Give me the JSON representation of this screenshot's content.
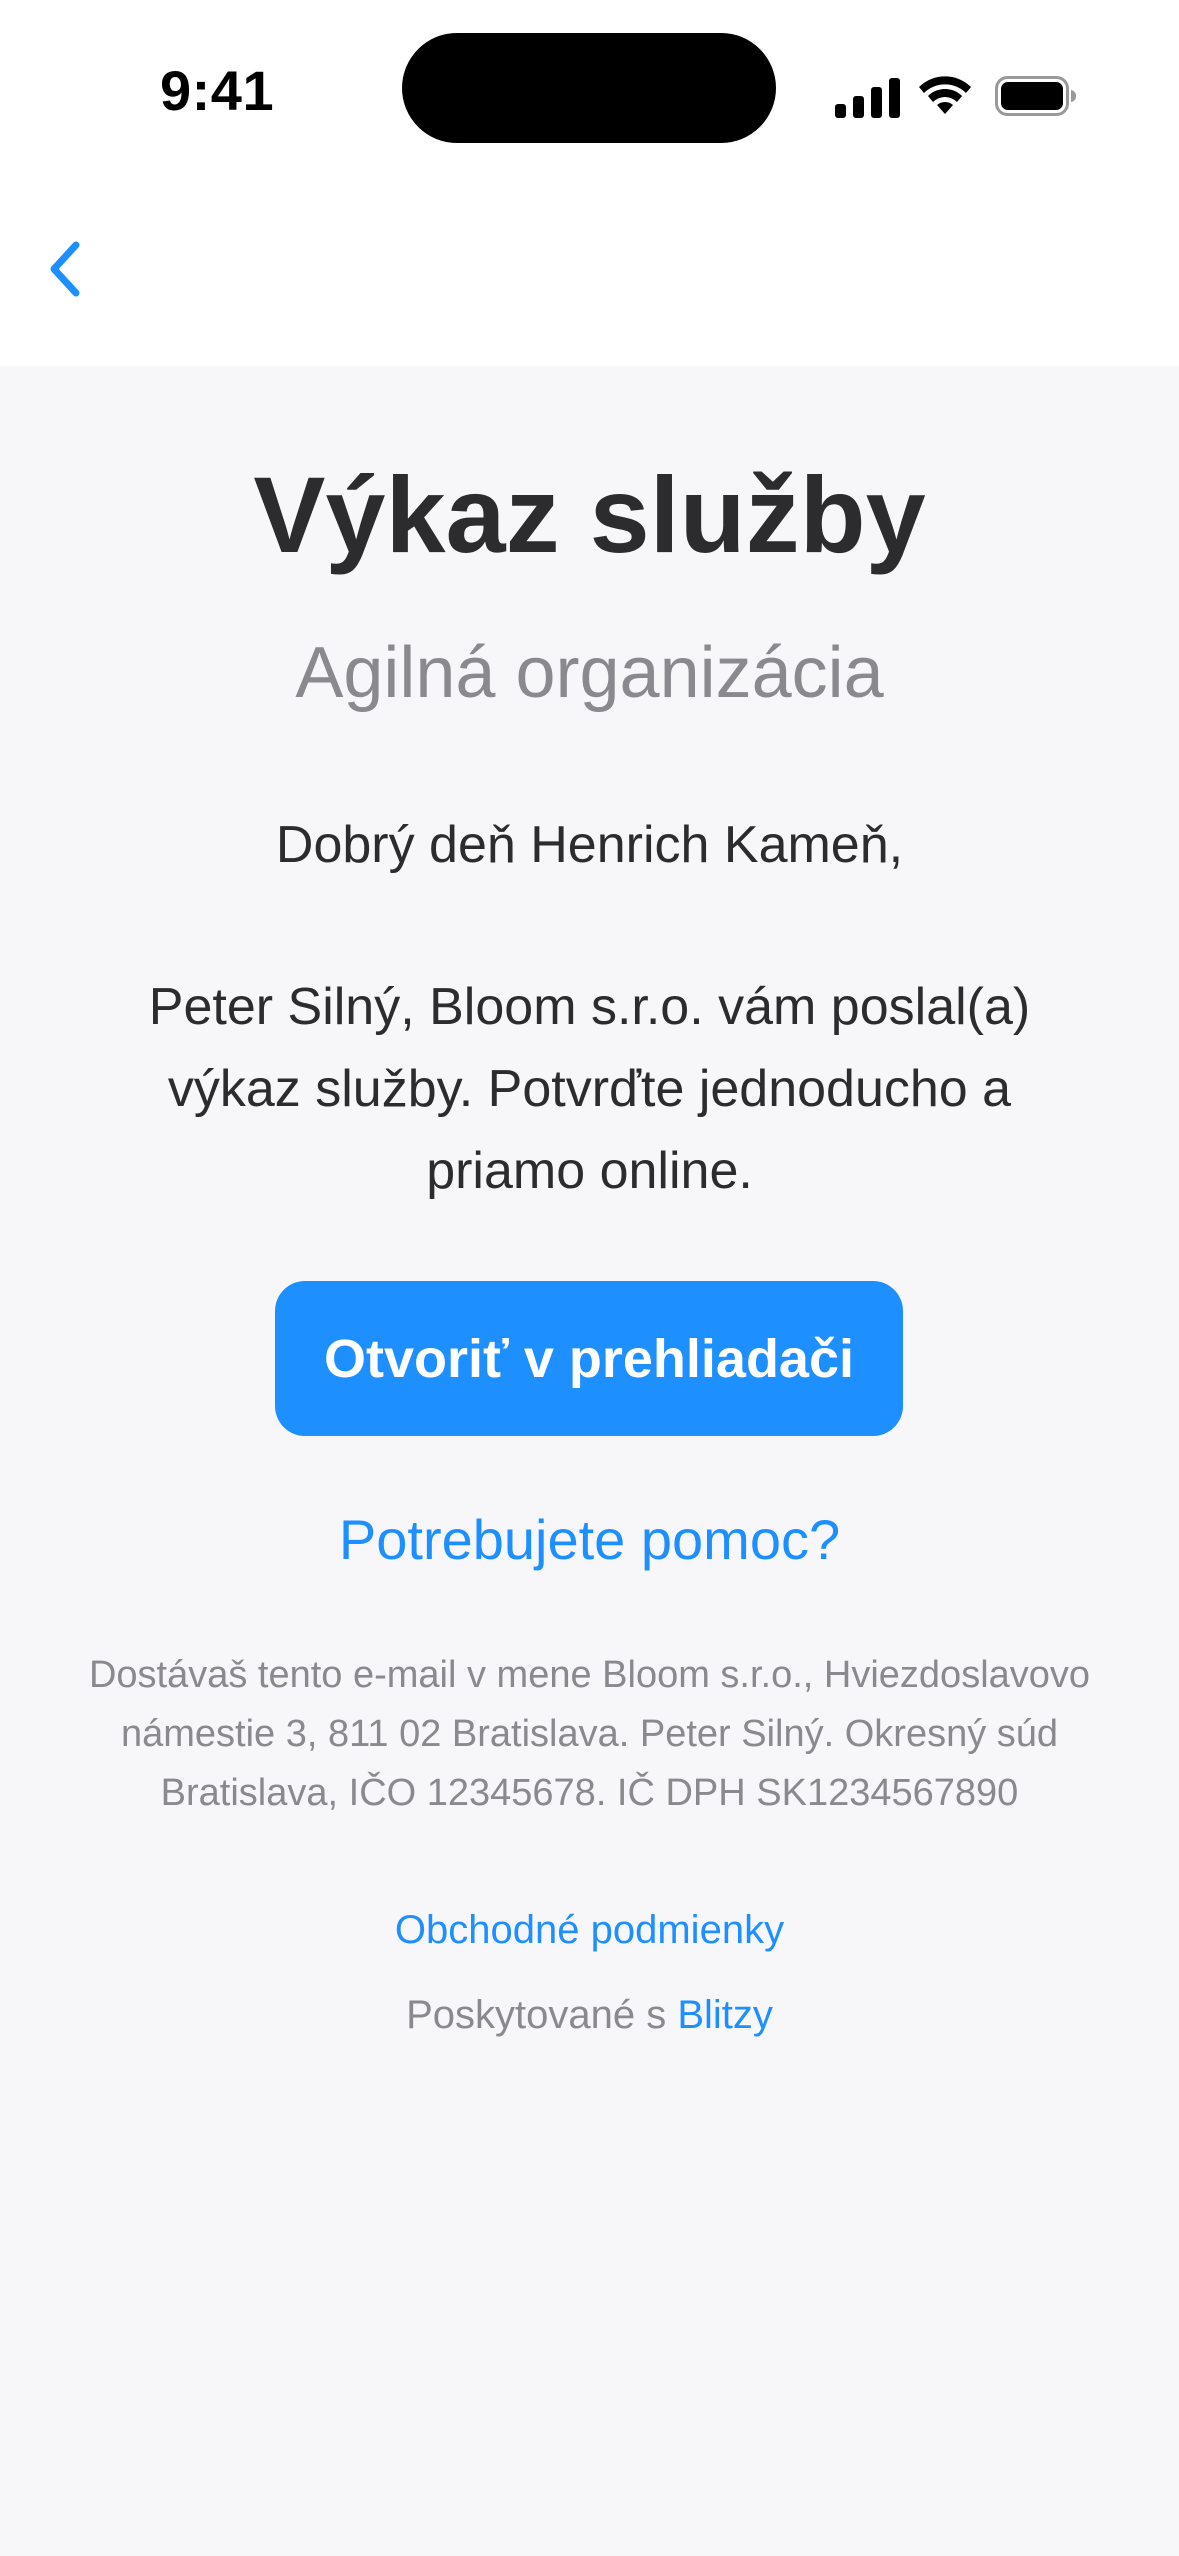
{
  "status_bar": {
    "time": "9:41"
  },
  "nav": {
    "back_icon": "chevron-left-icon"
  },
  "email": {
    "title": "Výkaz služby",
    "subtitle": "Agilná organizácia",
    "greeting": "Dobrý deň Henrich Kameň,",
    "body": "Peter Silný, Bloom s.r.o. vám poslal(a) výkaz služby. Potvrďte jednoducho a priamo online.",
    "open_button_label": "Otvoriť v prehliadači",
    "help_link": "Potrebujete pomoc?",
    "footer": "Dostávaš tento e-mail v mene Bloom s.r.o., Hviezdoslavovo námestie 3, 811 02 Bratislava. Peter Silný. Okresný súd Bratislava, IČO 12345678. IČ DPH SK1234567890",
    "terms_link": "Obchodné podmienky",
    "powered_prefix": "Poskytované s",
    "powered_brand": "Blitzy"
  },
  "colors": {
    "accent": "#1e8fff",
    "background": "#f7f7f9",
    "text_primary": "#2c2c2e",
    "text_secondary": "#8a8a8e"
  }
}
